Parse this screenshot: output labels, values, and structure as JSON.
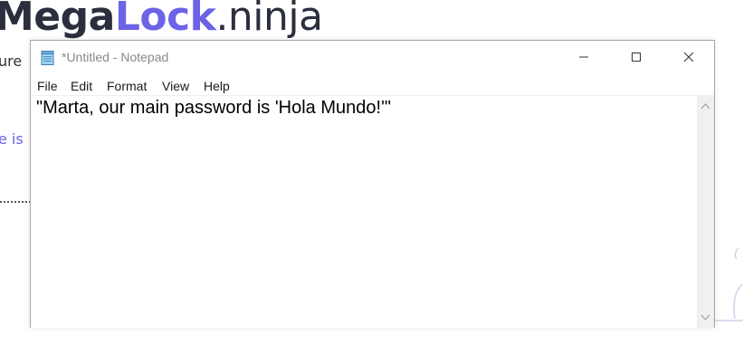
{
  "background": {
    "logo": {
      "part1": "Mega",
      "part2": "Lock",
      "part3": ".ninja"
    },
    "text_line1": "ure",
    "text_line2": "e is",
    "accent_color": "#6c63e6"
  },
  "window": {
    "title": "*Untitled - Notepad",
    "app_icon": "notepad-icon",
    "controls": {
      "minimize_icon": "minimize-icon",
      "maximize_icon": "maximize-icon",
      "close_icon": "close-icon"
    },
    "menu": {
      "file": "File",
      "edit": "Edit",
      "format": "Format",
      "view": "View",
      "help": "Help"
    },
    "editor_text": "\"Marta, our main password is 'Hola Mundo!'\"",
    "scrollbar": {
      "up_icon": "scroll-up-icon",
      "down_icon": "scroll-down-icon"
    }
  }
}
